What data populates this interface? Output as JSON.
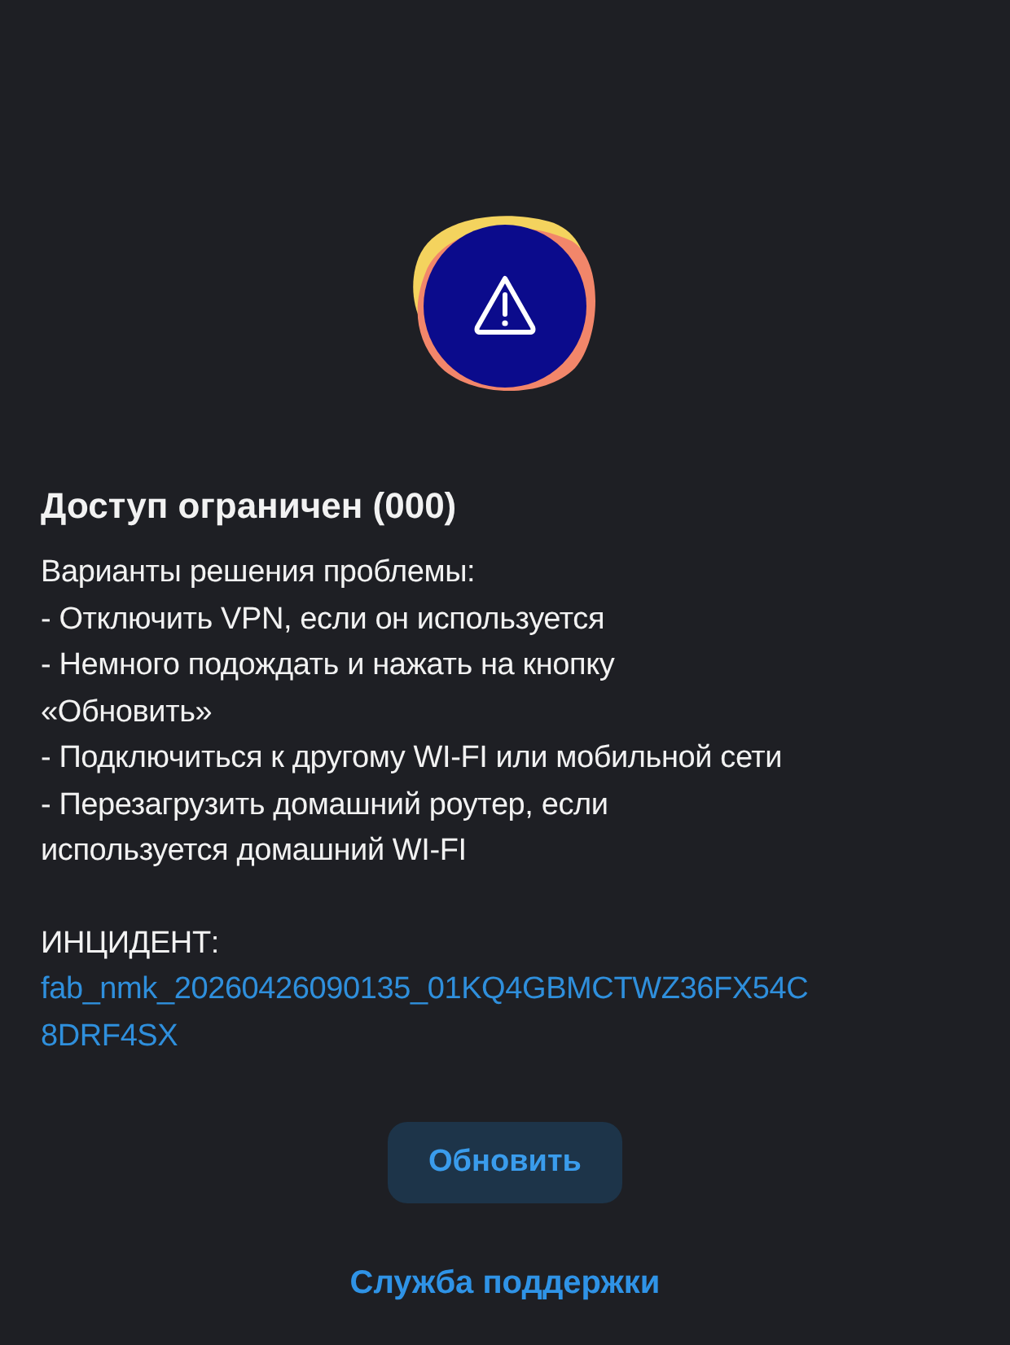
{
  "title": "Доступ ограничен (000)",
  "solution_lines": [
    "Варианты решения проблемы:",
    "- Отключить VPN, если он используется",
    "- Немного подождать и нажать на кнопку",
    "«Обновить»",
    "- Подключиться к другому WI-FI или мобильной сети",
    "- Перезагрузить домашний роутер, если",
    "используется домашний WI-FI"
  ],
  "incident_label": "ИНЦИДЕНТ:",
  "incident_id_lines": [
    "fab_nmk_20260426090135_01KQ4GBMCTWZ36FX54C",
    "8DRF4SX"
  ],
  "refresh_button": "Обновить",
  "support_link": "Служба поддержки"
}
